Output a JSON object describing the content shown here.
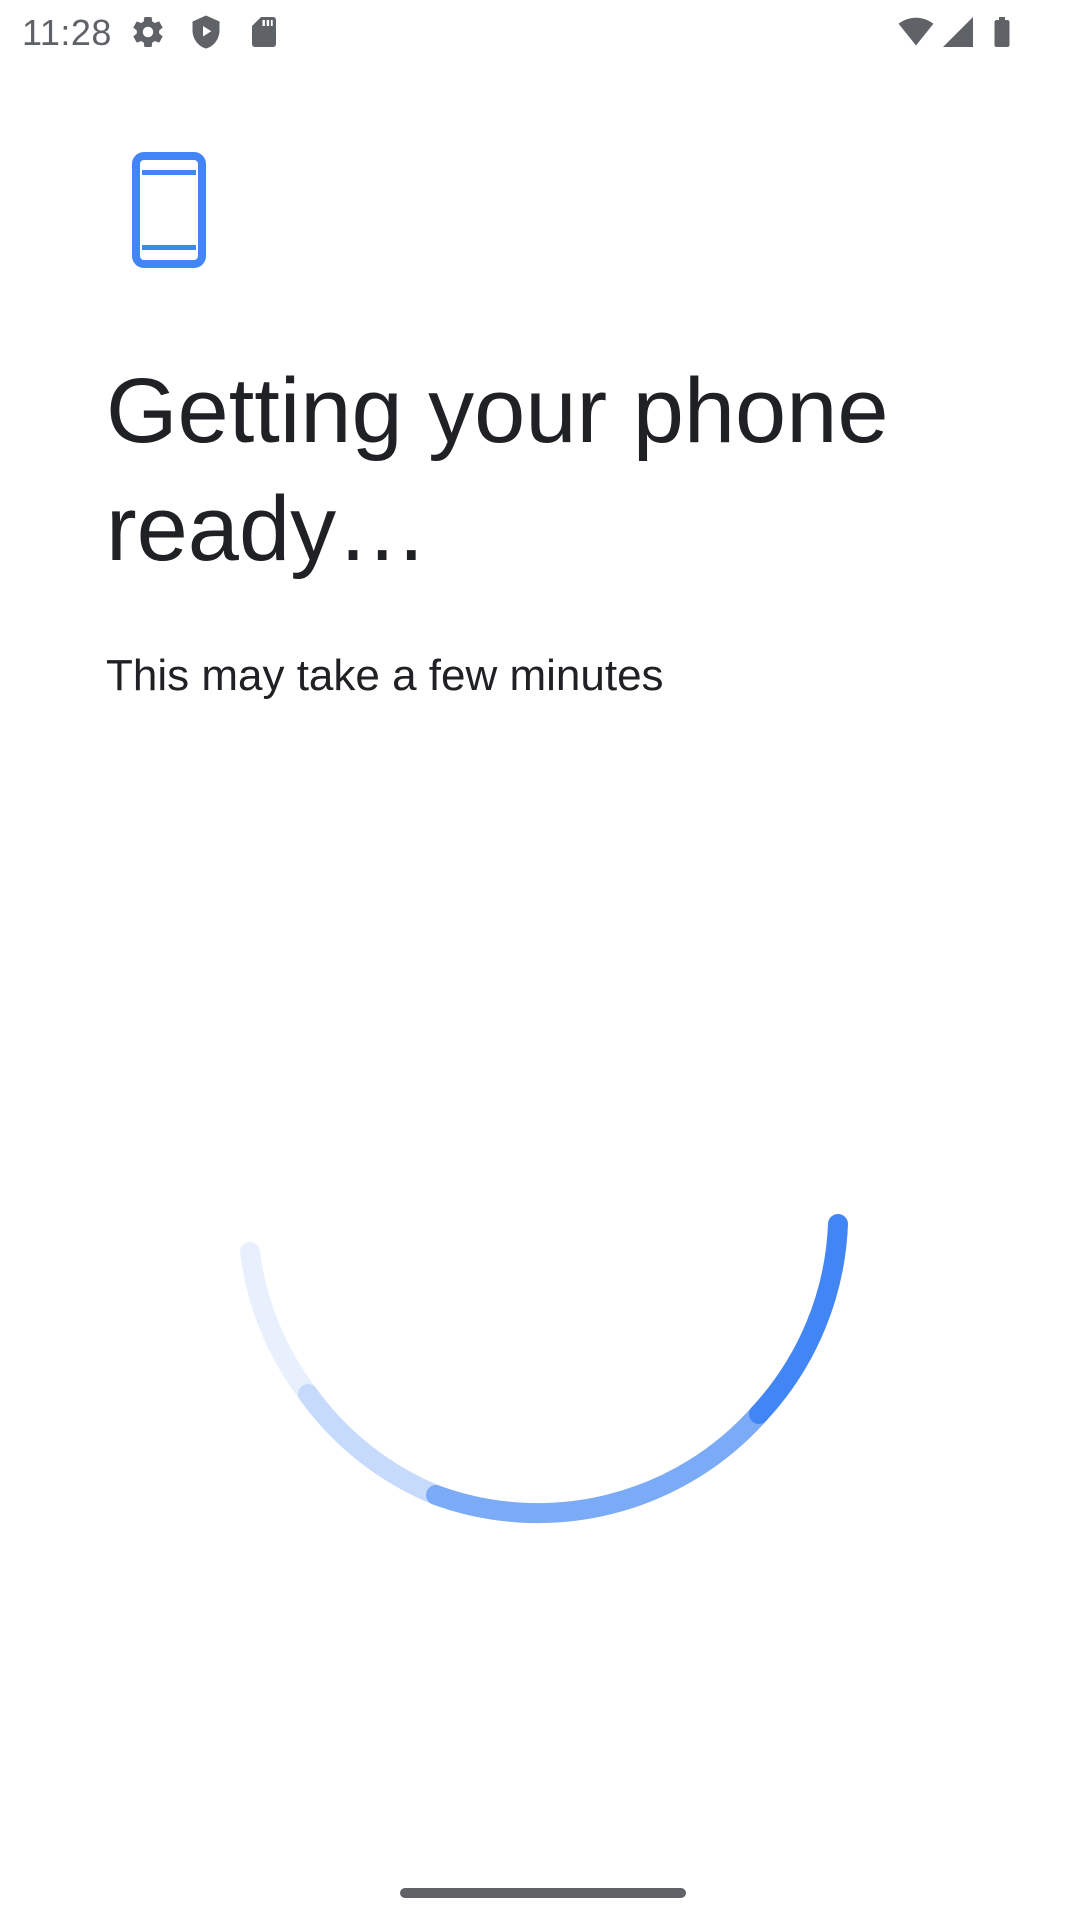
{
  "status_bar": {
    "time": "11:28",
    "left_icons": [
      "settings-icon",
      "shield-play-icon",
      "sd-card-icon"
    ],
    "right_icons": [
      "wifi-icon",
      "cellular-signal-icon",
      "battery-icon"
    ]
  },
  "setup": {
    "header_icon": "smartphone-icon",
    "title": "Getting your phone ready…",
    "subtitle": "This may take a few minutes"
  },
  "progress": {
    "type": "indeterminate-spinner"
  },
  "colors": {
    "accent": "#4285f4",
    "text_primary": "#202124",
    "text_secondary": "#5f6368",
    "background": "#ffffff"
  }
}
